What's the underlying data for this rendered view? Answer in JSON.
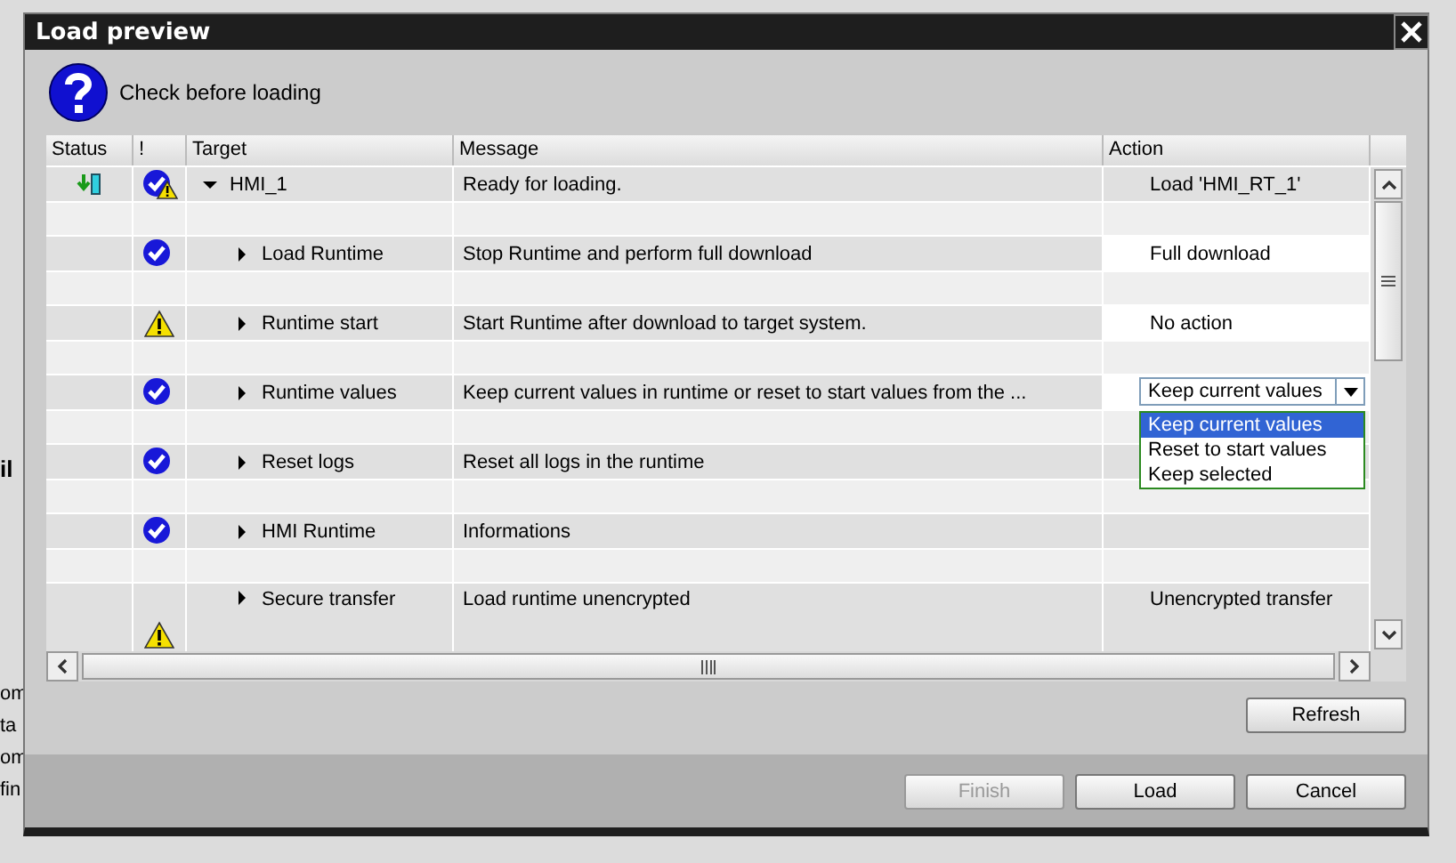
{
  "background": {
    "fragments": [
      {
        "text": "il",
        "bold": true
      },
      {
        "text": "om",
        "bold": false
      },
      {
        "text": "ta",
        "bold": false
      },
      {
        "text": "om",
        "bold": false
      },
      {
        "text": "fin",
        "bold": false
      }
    ]
  },
  "window": {
    "title": "Load preview"
  },
  "header": {
    "text": "Check before loading"
  },
  "table": {
    "columns": [
      "Status",
      "!",
      "Target",
      "Message",
      "Action"
    ],
    "rows": [
      {
        "download": true,
        "ok": true,
        "warning": true,
        "target": "HMI_1",
        "expanded": true,
        "message": "Ready for loading.",
        "action": {
          "kind": "text",
          "value": "Load 'HMI_RT_1'"
        },
        "children": [
          {
            "ok": true,
            "warning": false,
            "target": "Load Runtime",
            "expanded": false,
            "message": "Stop Runtime and perform full download",
            "action": {
              "kind": "editable",
              "value": "Full download"
            }
          },
          {
            "ok": false,
            "warning": true,
            "target": "Runtime start",
            "expanded": false,
            "message": "Start Runtime after download to target system.",
            "action": {
              "kind": "editable",
              "value": "No action"
            }
          },
          {
            "ok": true,
            "warning": false,
            "target": "Runtime values",
            "expanded": false,
            "message": "Keep current values in runtime or reset to start values from the ...",
            "action": {
              "kind": "dropdown",
              "value": "Keep current values",
              "open": true,
              "options": [
                {
                  "label": "Keep current values",
                  "selected": true
                },
                {
                  "label": "Reset to start values",
                  "selected": false
                },
                {
                  "label": "Keep selected",
                  "selected": false
                }
              ]
            }
          },
          {
            "ok": true,
            "warning": false,
            "target": "Reset logs",
            "expanded": false,
            "message": "Reset all logs in the runtime"
          },
          {
            "ok": true,
            "warning": false,
            "target": "HMI Runtime",
            "expanded": false,
            "message": "Informations"
          },
          {
            "ok": false,
            "warning": true,
            "tall": true,
            "target": "Secure transfer",
            "expanded": false,
            "message": "Load runtime unencrypted",
            "action": {
              "kind": "text",
              "value": "Unencrypted transfer"
            }
          }
        ]
      }
    ]
  },
  "refresh_button": {
    "label": "Refresh"
  },
  "footer_buttons": [
    {
      "label": "Finish",
      "disabled": true
    },
    {
      "label": "Load",
      "disabled": false
    },
    {
      "label": "Cancel",
      "disabled": false
    }
  ]
}
